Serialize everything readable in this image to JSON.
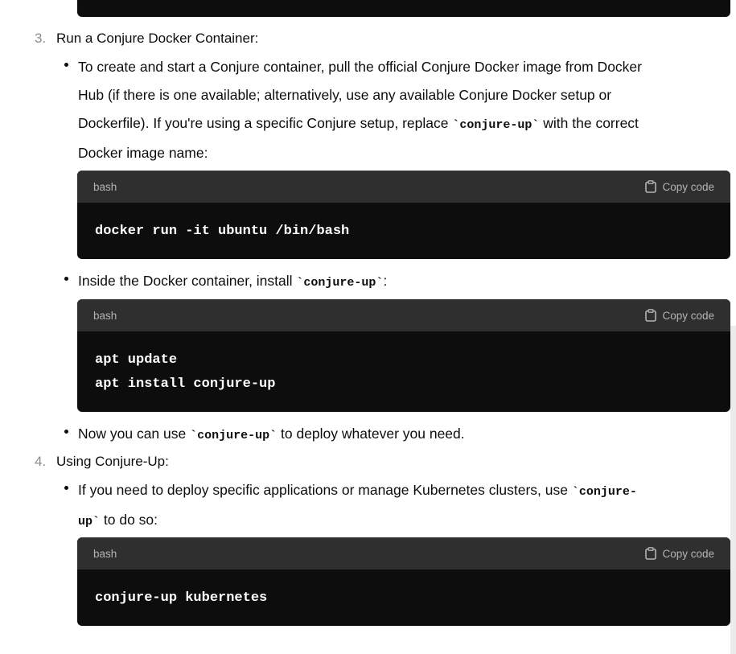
{
  "section3": {
    "number": "3.",
    "title": "Run a Conjure Docker Container:",
    "bullet1": {
      "line1": "To create and start a Conjure container, pull the official Conjure Docker image from Docker",
      "line2": "Hub (if there is one available; alternatively, use any available Conjure Docker setup or",
      "line3_a": "Dockerfile). If you're using a specific Conjure setup, replace ",
      "line3_code": "`conjure-up`",
      "line3_b": " with the correct",
      "line4": "Docker image name:"
    },
    "code1": {
      "lang": "bash",
      "copy_label": "Copy code",
      "lines": [
        "docker run -it ubuntu /bin/bash"
      ]
    },
    "bullet2": {
      "text_a": "Inside the Docker container, install ",
      "code": "`conjure-up`",
      "text_b": ":"
    },
    "code2": {
      "lang": "bash",
      "copy_label": "Copy code",
      "lines": [
        "apt update",
        "apt install conjure-up"
      ]
    },
    "bullet3": {
      "text_a": "Now you can use ",
      "code": "`conjure-up`",
      "text_b": " to deploy whatever you need."
    }
  },
  "section4": {
    "number": "4.",
    "title": "Using Conjure-Up:",
    "bullet1": {
      "text_a": "If you need to deploy specific applications or manage Kubernetes clusters, use ",
      "code_a": "`conjure-",
      "code_b": "up`",
      "text_b": " to do so:"
    },
    "code1": {
      "lang": "bash",
      "copy_label": "Copy code",
      "lines": [
        "conjure-up kubernetes"
      ]
    }
  }
}
